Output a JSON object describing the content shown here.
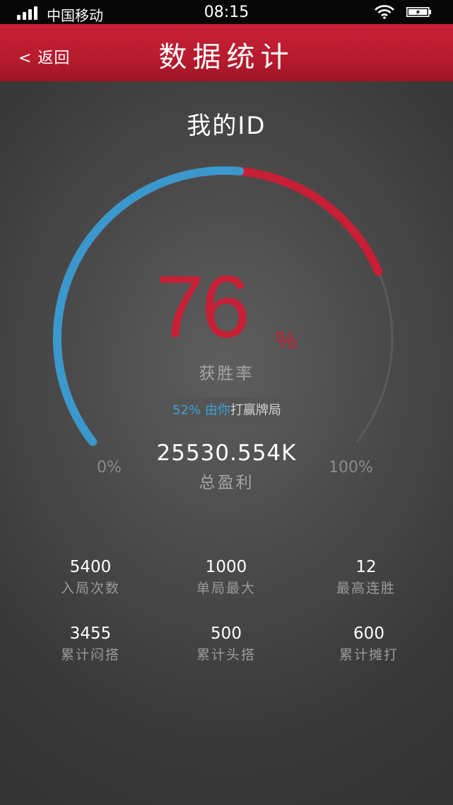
{
  "status_bar": {
    "carrier": "中国移动",
    "time": "08:15"
  },
  "nav": {
    "back_label": "< 返回",
    "title": "数据统计"
  },
  "page_title": "我的ID",
  "gauge": {
    "win_rate_value": "76",
    "win_rate_percent_sign": "%",
    "win_rate_fraction": 0.76,
    "self_played_fraction": 0.52,
    "rate_label": "获胜率",
    "self_percent": "52%",
    "self_text_blue": "由你",
    "self_text_grey": "打赢牌局",
    "min_label": "0%",
    "max_label": "100%",
    "colors": {
      "blue": "#3a98cc",
      "red": "#c71f35",
      "track": "#5a5a5a"
    }
  },
  "profit": {
    "value": "25530.554K",
    "label": "总盈利"
  },
  "stats": [
    {
      "value": "5400",
      "label": "入局次数"
    },
    {
      "value": "1000",
      "label": "单局最大"
    },
    {
      "value": "12",
      "label": "最高连胜"
    },
    {
      "value": "3455",
      "label": "累计闷搭"
    },
    {
      "value": "500",
      "label": "累计头搭"
    },
    {
      "value": "600",
      "label": "累计摊打"
    }
  ]
}
